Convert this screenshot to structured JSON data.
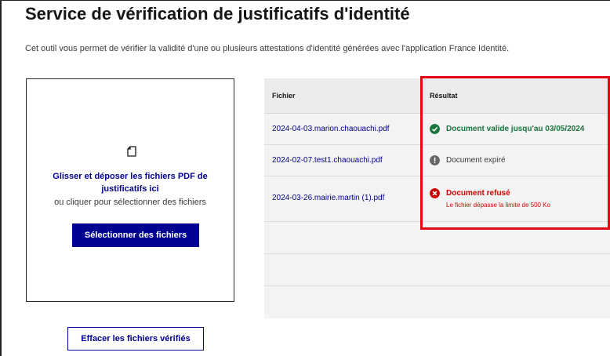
{
  "page": {
    "title": "Service de vérification de justificatifs d'identité",
    "intro": "Cet outil vous permet de vérifier la validité d'une ou plusieurs attestations d'identité générées avec l'application France Identité."
  },
  "dropzone": {
    "icon": "document-icon",
    "title": "Glisser et déposer les fichiers PDF de justificatifs ici",
    "subtitle": "ou cliquer pour sélectionner des fichiers",
    "select_button": "Sélectionner des fichiers"
  },
  "clear_button": "Effacer les fichiers vérifiés",
  "table": {
    "headers": {
      "file": "Fichier",
      "result": "Résultat"
    },
    "rows": [
      {
        "file": "2024-04-03.marion.chaouachi.pdf",
        "status": "valid",
        "status_icon": "check-circle-icon",
        "status_color": "#18753c",
        "result": "Document valide jusqu'au 03/05/2024",
        "detail": ""
      },
      {
        "file": "2024-02-07.test1.chaouachi.pdf",
        "status": "expired",
        "status_icon": "alert-circle-icon",
        "status_color": "#666666",
        "result": "Document expiré",
        "detail": ""
      },
      {
        "file": "2024-03-26.mairie.martin (1).pdf",
        "status": "refused",
        "status_icon": "close-circle-icon",
        "status_color": "#ce0500",
        "result": "Document refusé",
        "detail": "Le fichier dépasse la limite de 500 Ko"
      }
    ]
  },
  "colors": {
    "primary": "#000091",
    "success": "#18753c",
    "error": "#ce0500",
    "highlight": "#e30613"
  }
}
